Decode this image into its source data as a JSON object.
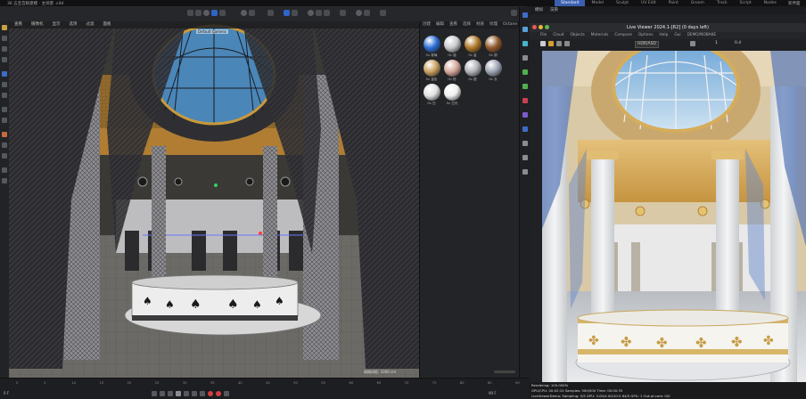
{
  "window": {
    "title": "36 五宝宫殿建模 - 主场景 .c4d"
  },
  "layout_tabs": [
    {
      "label": "Standard",
      "active": true
    },
    {
      "label": "Model",
      "active": false
    },
    {
      "label": "Sculpt",
      "active": false
    },
    {
      "label": "UV Edit",
      "active": false
    },
    {
      "label": "Paint",
      "active": false
    },
    {
      "label": "Groom",
      "active": false
    },
    {
      "label": "Track",
      "active": false
    },
    {
      "label": "Script",
      "active": false
    },
    {
      "label": "Nodes",
      "active": false
    }
  ],
  "window_controls": "新界面",
  "viewport": {
    "menu": [
      "查看",
      "摄像机",
      "显示",
      "选项",
      "过滤",
      "面板"
    ],
    "camera_label": "Default Camera",
    "info": "网格间距: 1000 cm"
  },
  "material_browser": {
    "menu": [
      "创建",
      "编辑",
      "查看",
      "选择",
      "材质",
      "纹理",
      "Octane"
    ],
    "materials": [
      {
        "label": "Oc 玻璃",
        "color": "#2d6fd6"
      },
      {
        "label": "Oc 铬",
        "color": "#c8c9cc"
      },
      {
        "label": "Oc 金",
        "color": "#b07a2a"
      },
      {
        "label": "Oc 铜",
        "color": "#8f5a2c"
      },
      {
        "label": "Oc 金色",
        "color": "#c8a060"
      },
      {
        "label": "Oc 粉",
        "color": "#d6a89c"
      },
      {
        "label": "Oc 银",
        "color": "#b0b2b8"
      },
      {
        "label": "Oc 灰",
        "color": "#9ea4b4"
      },
      {
        "label": "Oc 白",
        "color": "#e2e2e2"
      },
      {
        "label": "Oc 白光",
        "color": "#f0f0f0"
      }
    ]
  },
  "live_viewer": {
    "menu": [
      "模拟",
      "渲染"
    ],
    "title": "Live Viewer 2024.1-[R2] (0 days left)",
    "menu2": [
      "File",
      "Cloud",
      "Objects",
      "Materials",
      "Compare",
      "Options",
      "Help",
      "Gui",
      "DEMO/NOBAKE"
    ],
    "ctrl": {
      "mode": "HDR/ASD",
      "value1": "1",
      "value2": "0.4"
    },
    "status": [
      "Rendering: 100.000%",
      "GPU/CPU: 00:02:15   Samples: 500/500   Time: 00:00:35",
      "LiveViewerDemo:  Sampling: 5/5   GPU: 3.00/4.00/10:5 64/5   GPU: 1  Out-of-core: 0/0"
    ]
  },
  "timeline": {
    "ticks": [
      "0",
      "5",
      "10",
      "15",
      "20",
      "25",
      "30",
      "35",
      "40",
      "45",
      "50",
      "55",
      "60",
      "65",
      "70",
      "75",
      "80",
      "85",
      "90"
    ],
    "current_frame": "0 F",
    "end_frame": "90 F"
  }
}
